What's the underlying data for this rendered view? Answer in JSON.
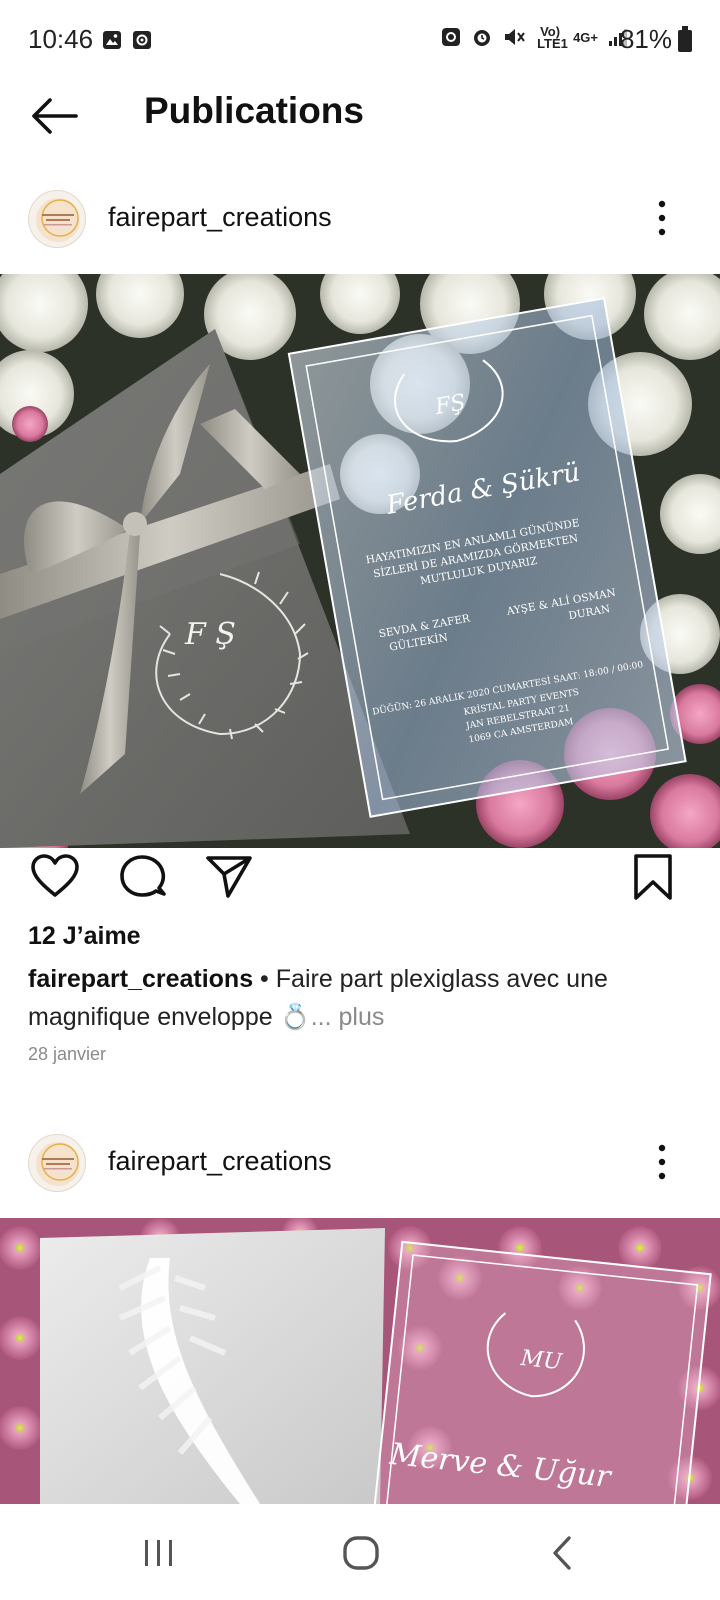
{
  "status_bar": {
    "time": "10:46",
    "battery": "81%",
    "network_volte": "Vo) LTE1",
    "network_gen": "4G+"
  },
  "header": {
    "title": "Publications",
    "back_icon": "arrow-left-icon"
  },
  "posts": [
    {
      "username": "fairepart_creations",
      "likes": "12 J’aime",
      "caption_user": "fairepart_creations",
      "caption_separator": " • ",
      "caption_text": "Faire part plexiglass avec une magnifique enveloppe 💍",
      "caption_more": "... plus",
      "date": "28 janvier",
      "photo_text": {
        "names": "Ferda & Şükrü",
        "monogram": "FŞ",
        "line1": "HAYATIMIZIN EN ANLAMLI GÜNÜNDE",
        "line2": "SİZLERİ DE ARAMIZDA GÖRMEKTEN",
        "line3": "MUTLULUK DUYARIZ",
        "parents_left": "SEVDA & ZAFER",
        "parents_left2": "GÜLTEKİN",
        "parents_right": "AYŞE & ALİ OSMAN",
        "parents_right2": "DURAN",
        "event1": "DÜĞÜN: 26 ARALIK 2020 CUMARTESİ SAAT: 18:00 / 00:00",
        "event2": "KRİSTAL PARTY EVENTS",
        "event3": "JAN REBELSTRAAT 21",
        "event4": "1069 CA AMSTERDAM"
      }
    },
    {
      "username": "fairepart_creations",
      "photo_text": {
        "monogram": "MU",
        "names": "Merve & Uğur"
      }
    }
  ],
  "nav_bar": {
    "recents_icon": "recents-icon",
    "home_icon": "home-icon",
    "back_icon": "nav-back-icon"
  },
  "colors": {
    "text": "#111111",
    "muted": "#8a8a8a",
    "envelope_gray": "#6e6e6c",
    "ribbon_silver": "#b9b6ad",
    "flowers_pink": "#d9799e"
  }
}
